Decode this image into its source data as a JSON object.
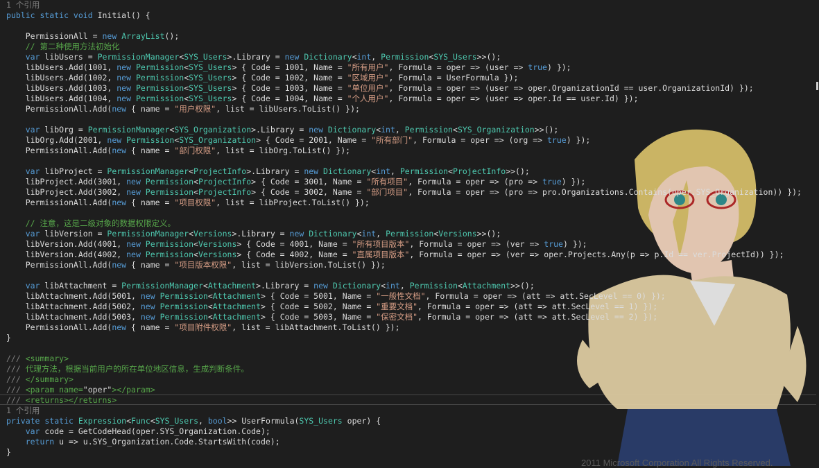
{
  "editor": {
    "lines": [
      {
        "kind": "ref",
        "tokens": [
          [
            "g",
            "1 个引用"
          ]
        ]
      },
      {
        "tokens": [
          [
            "k",
            "public static void "
          ],
          [
            "p",
            "Initial() {"
          ]
        ]
      },
      {
        "tokens": [
          [
            "p",
            ""
          ]
        ]
      },
      {
        "tokens": [
          [
            "p",
            "    PermissionAll = "
          ],
          [
            "k",
            "new "
          ],
          [
            "t",
            "ArrayList"
          ],
          [
            "p",
            "();"
          ]
        ]
      },
      {
        "tokens": [
          [
            "c",
            "    // 第二种使用方法初始化"
          ]
        ]
      },
      {
        "tokens": [
          [
            "k",
            "    var "
          ],
          [
            "p",
            "libUsers = "
          ],
          [
            "t",
            "PermissionManager"
          ],
          [
            "p",
            "<"
          ],
          [
            "t",
            "SYS_Users"
          ],
          [
            "p",
            ">.Library = "
          ],
          [
            "k",
            "new "
          ],
          [
            "t",
            "Dictionary"
          ],
          [
            "p",
            "<"
          ],
          [
            "k",
            "int"
          ],
          [
            "p",
            ", "
          ],
          [
            "t",
            "Permission"
          ],
          [
            "p",
            "<"
          ],
          [
            "t",
            "SYS_Users"
          ],
          [
            "p",
            ">>();"
          ]
        ]
      },
      {
        "tokens": [
          [
            "p",
            "    libUsers.Add(1001, "
          ],
          [
            "k",
            "new "
          ],
          [
            "t",
            "Permission"
          ],
          [
            "p",
            "<"
          ],
          [
            "t",
            "SYS_Users"
          ],
          [
            "p",
            "> { Code = 1001, Name = "
          ],
          [
            "s",
            "\"所有用户\""
          ],
          [
            "p",
            ", Formula = oper => (user => "
          ],
          [
            "k",
            "true"
          ],
          [
            "p",
            ") });"
          ]
        ]
      },
      {
        "tokens": [
          [
            "p",
            "    libUsers.Add(1002, "
          ],
          [
            "k",
            "new "
          ],
          [
            "t",
            "Permission"
          ],
          [
            "p",
            "<"
          ],
          [
            "t",
            "SYS_Users"
          ],
          [
            "p",
            "> { Code = 1002, Name = "
          ],
          [
            "s",
            "\"区域用户\""
          ],
          [
            "p",
            ", Formula = UserFormula });"
          ]
        ]
      },
      {
        "tokens": [
          [
            "p",
            "    libUsers.Add(1003, "
          ],
          [
            "k",
            "new "
          ],
          [
            "t",
            "Permission"
          ],
          [
            "p",
            "<"
          ],
          [
            "t",
            "SYS_Users"
          ],
          [
            "p",
            "> { Code = 1003, Name = "
          ],
          [
            "s",
            "\"单位用户\""
          ],
          [
            "p",
            ", Formula = oper => (user => oper.OrganizationId == user.OrganizationId) });"
          ]
        ]
      },
      {
        "tokens": [
          [
            "p",
            "    libUsers.Add(1004, "
          ],
          [
            "k",
            "new "
          ],
          [
            "t",
            "Permission"
          ],
          [
            "p",
            "<"
          ],
          [
            "t",
            "SYS_Users"
          ],
          [
            "p",
            "> { Code = 1004, Name = "
          ],
          [
            "s",
            "\"个人用户\""
          ],
          [
            "p",
            ", Formula = oper => (user => oper.Id == user.Id) });"
          ]
        ]
      },
      {
        "tokens": [
          [
            "p",
            "    PermissionAll.Add("
          ],
          [
            "k",
            "new "
          ],
          [
            "p",
            "{ name = "
          ],
          [
            "s",
            "\"用户权限\""
          ],
          [
            "p",
            ", list = libUsers.ToList() });"
          ]
        ]
      },
      {
        "tokens": [
          [
            "p",
            ""
          ]
        ]
      },
      {
        "tokens": [
          [
            "k",
            "    var "
          ],
          [
            "p",
            "libOrg = "
          ],
          [
            "t",
            "PermissionManager"
          ],
          [
            "p",
            "<"
          ],
          [
            "t",
            "SYS_Organization"
          ],
          [
            "p",
            ">.Library = "
          ],
          [
            "k",
            "new "
          ],
          [
            "t",
            "Dictionary"
          ],
          [
            "p",
            "<"
          ],
          [
            "k",
            "int"
          ],
          [
            "p",
            ", "
          ],
          [
            "t",
            "Permission"
          ],
          [
            "p",
            "<"
          ],
          [
            "t",
            "SYS_Organization"
          ],
          [
            "p",
            ">>();"
          ]
        ]
      },
      {
        "tokens": [
          [
            "p",
            "    libOrg.Add(2001, "
          ],
          [
            "k",
            "new "
          ],
          [
            "t",
            "Permission"
          ],
          [
            "p",
            "<"
          ],
          [
            "t",
            "SYS_Organization"
          ],
          [
            "p",
            "> { Code = 2001, Name = "
          ],
          [
            "s",
            "\"所有部门\""
          ],
          [
            "p",
            ", Formula = oper => (org => "
          ],
          [
            "k",
            "true"
          ],
          [
            "p",
            ") });"
          ]
        ]
      },
      {
        "tokens": [
          [
            "p",
            "    PermissionAll.Add("
          ],
          [
            "k",
            "new "
          ],
          [
            "p",
            "{ name = "
          ],
          [
            "s",
            "\"部门权限\""
          ],
          [
            "p",
            ", list = libOrg.ToList() });"
          ]
        ]
      },
      {
        "tokens": [
          [
            "p",
            ""
          ]
        ]
      },
      {
        "tokens": [
          [
            "k",
            "    var "
          ],
          [
            "p",
            "libProject = "
          ],
          [
            "t",
            "PermissionManager"
          ],
          [
            "p",
            "<"
          ],
          [
            "t",
            "ProjectInfo"
          ],
          [
            "p",
            ">.Library = "
          ],
          [
            "k",
            "new "
          ],
          [
            "t",
            "Dictionary"
          ],
          [
            "p",
            "<"
          ],
          [
            "k",
            "int"
          ],
          [
            "p",
            ", "
          ],
          [
            "t",
            "Permission"
          ],
          [
            "p",
            "<"
          ],
          [
            "t",
            "ProjectInfo"
          ],
          [
            "p",
            ">>();"
          ]
        ]
      },
      {
        "tokens": [
          [
            "p",
            "    libProject.Add(3001, "
          ],
          [
            "k",
            "new "
          ],
          [
            "t",
            "Permission"
          ],
          [
            "p",
            "<"
          ],
          [
            "t",
            "ProjectInfo"
          ],
          [
            "p",
            "> { Code = 3001, Name = "
          ],
          [
            "s",
            "\"所有项目\""
          ],
          [
            "p",
            ", Formula = oper => (pro => "
          ],
          [
            "k",
            "true"
          ],
          [
            "p",
            ") });"
          ]
        ]
      },
      {
        "tokens": [
          [
            "p",
            "    libProject.Add(3002, "
          ],
          [
            "k",
            "new "
          ],
          [
            "t",
            "Permission"
          ],
          [
            "p",
            "<"
          ],
          [
            "t",
            "ProjectInfo"
          ],
          [
            "p",
            "> { Code = 3002, Name = "
          ],
          [
            "s",
            "\"部门项目\""
          ],
          [
            "p",
            ", Formula = oper => (pro => pro.Organizations.Contains(oper.SYS_Organization)) });"
          ]
        ]
      },
      {
        "tokens": [
          [
            "p",
            "    PermissionAll.Add("
          ],
          [
            "k",
            "new "
          ],
          [
            "p",
            "{ name = "
          ],
          [
            "s",
            "\"项目权限\""
          ],
          [
            "p",
            ", list = libProject.ToList() });"
          ]
        ]
      },
      {
        "tokens": [
          [
            "p",
            ""
          ]
        ]
      },
      {
        "tokens": [
          [
            "c",
            "    // 注意，这是二级对象的数据权限定义。"
          ]
        ]
      },
      {
        "tokens": [
          [
            "k",
            "    var "
          ],
          [
            "p",
            "libVersion = "
          ],
          [
            "t",
            "PermissionManager"
          ],
          [
            "p",
            "<"
          ],
          [
            "t",
            "Versions"
          ],
          [
            "p",
            ">.Library = "
          ],
          [
            "k",
            "new "
          ],
          [
            "t",
            "Dictionary"
          ],
          [
            "p",
            "<"
          ],
          [
            "k",
            "int"
          ],
          [
            "p",
            ", "
          ],
          [
            "t",
            "Permission"
          ],
          [
            "p",
            "<"
          ],
          [
            "t",
            "Versions"
          ],
          [
            "p",
            ">>();"
          ]
        ]
      },
      {
        "tokens": [
          [
            "p",
            "    libVersion.Add(4001, "
          ],
          [
            "k",
            "new "
          ],
          [
            "t",
            "Permission"
          ],
          [
            "p",
            "<"
          ],
          [
            "t",
            "Versions"
          ],
          [
            "p",
            "> { Code = 4001, Name = "
          ],
          [
            "s",
            "\"所有项目版本\""
          ],
          [
            "p",
            ", Formula = oper => (ver => "
          ],
          [
            "k",
            "true"
          ],
          [
            "p",
            ") });"
          ]
        ]
      },
      {
        "tokens": [
          [
            "p",
            "    libVersion.Add(4002, "
          ],
          [
            "k",
            "new "
          ],
          [
            "t",
            "Permission"
          ],
          [
            "p",
            "<"
          ],
          [
            "t",
            "Versions"
          ],
          [
            "p",
            "> { Code = 4002, Name = "
          ],
          [
            "s",
            "\"直属项目版本\""
          ],
          [
            "p",
            ", Formula = oper => (ver => oper.Projects.Any(p => p.Id == ver.ProjectId)) });"
          ]
        ]
      },
      {
        "tokens": [
          [
            "p",
            "    PermissionAll.Add("
          ],
          [
            "k",
            "new "
          ],
          [
            "p",
            "{ name = "
          ],
          [
            "s",
            "\"项目版本权限\""
          ],
          [
            "p",
            ", list = libVersion.ToList() });"
          ]
        ]
      },
      {
        "tokens": [
          [
            "p",
            ""
          ]
        ]
      },
      {
        "tokens": [
          [
            "k",
            "    var "
          ],
          [
            "p",
            "libAttachment = "
          ],
          [
            "t",
            "PermissionManager"
          ],
          [
            "p",
            "<"
          ],
          [
            "t",
            "Attachment"
          ],
          [
            "p",
            ">.Library = "
          ],
          [
            "k",
            "new "
          ],
          [
            "t",
            "Dictionary"
          ],
          [
            "p",
            "<"
          ],
          [
            "k",
            "int"
          ],
          [
            "p",
            ", "
          ],
          [
            "t",
            "Permission"
          ],
          [
            "p",
            "<"
          ],
          [
            "t",
            "Attachment"
          ],
          [
            "p",
            ">>();"
          ]
        ]
      },
      {
        "tokens": [
          [
            "p",
            "    libAttachment.Add(5001, "
          ],
          [
            "k",
            "new "
          ],
          [
            "t",
            "Permission"
          ],
          [
            "p",
            "<"
          ],
          [
            "t",
            "Attachment"
          ],
          [
            "p",
            "> { Code = 5001, Name = "
          ],
          [
            "s",
            "\"一般性文档\""
          ],
          [
            "p",
            ", Formula = oper => (att => att.SecLevel == 0) });"
          ]
        ]
      },
      {
        "tokens": [
          [
            "p",
            "    libAttachment.Add(5002, "
          ],
          [
            "k",
            "new "
          ],
          [
            "t",
            "Permission"
          ],
          [
            "p",
            "<"
          ],
          [
            "t",
            "Attachment"
          ],
          [
            "p",
            "> { Code = 5002, Name = "
          ],
          [
            "s",
            "\"重要文档\""
          ],
          [
            "p",
            ", Formula = oper => (att => att.SecLevel == 1) });"
          ]
        ]
      },
      {
        "tokens": [
          [
            "p",
            "    libAttachment.Add(5003, "
          ],
          [
            "k",
            "new "
          ],
          [
            "t",
            "Permission"
          ],
          [
            "p",
            "<"
          ],
          [
            "t",
            "Attachment"
          ],
          [
            "p",
            "> { Code = 5003, Name = "
          ],
          [
            "s",
            "\"保密文档\""
          ],
          [
            "p",
            ", Formula = oper => (att => att.SecLevel == 2) });"
          ]
        ]
      },
      {
        "tokens": [
          [
            "p",
            "    PermissionAll.Add("
          ],
          [
            "k",
            "new "
          ],
          [
            "p",
            "{ name = "
          ],
          [
            "s",
            "\"项目附件权限\""
          ],
          [
            "p",
            ", list = libAttachment.ToList() });"
          ]
        ]
      },
      {
        "tokens": [
          [
            "p",
            "}"
          ]
        ]
      },
      {
        "tokens": [
          [
            "p",
            ""
          ]
        ]
      },
      {
        "tokens": [
          [
            "g",
            "/// "
          ],
          [
            "c",
            "<summary>"
          ]
        ]
      },
      {
        "tokens": [
          [
            "g",
            "/// "
          ],
          [
            "c",
            "代理方法，根据当前用户的所在单位地区信息，生成判断条件。"
          ]
        ]
      },
      {
        "tokens": [
          [
            "g",
            "/// "
          ],
          [
            "c",
            "</summary>"
          ]
        ]
      },
      {
        "tokens": [
          [
            "g",
            "/// "
          ],
          [
            "c",
            "<param name="
          ],
          [
            "p",
            "\"oper\""
          ],
          [
            "c",
            "></param>"
          ]
        ]
      },
      {
        "tokens": [
          [
            "g",
            "/// "
          ],
          [
            "c",
            "<returns></returns>"
          ]
        ]
      },
      {
        "kind": "ref",
        "tokens": [
          [
            "g",
            "1 个引用"
          ]
        ]
      },
      {
        "tokens": [
          [
            "k",
            "private static "
          ],
          [
            "t",
            "Expression"
          ],
          [
            "p",
            "<"
          ],
          [
            "t",
            "Func"
          ],
          [
            "p",
            "<"
          ],
          [
            "t",
            "SYS_Users"
          ],
          [
            "p",
            ", "
          ],
          [
            "k",
            "bool"
          ],
          [
            "p",
            ">> UserFormula("
          ],
          [
            "t",
            "SYS_Users "
          ],
          [
            "p",
            "oper) {"
          ]
        ]
      },
      {
        "tokens": [
          [
            "k",
            "    var "
          ],
          [
            "p",
            "code = GetCodeHead(oper.SYS_Organization.Code);"
          ]
        ]
      },
      {
        "tokens": [
          [
            "k",
            "    return "
          ],
          [
            "p",
            "u => u.SYS_Organization.Code.StartsWith(code);"
          ]
        ]
      },
      {
        "tokens": [
          [
            "p",
            "}"
          ]
        ]
      }
    ]
  },
  "background": {
    "copyright": "2011 Microsoft Corporation All Rights Reserved."
  },
  "colors": {
    "keyword": "#569cd6",
    "type": "#4ec9b0",
    "string": "#d69d85",
    "comment": "#57a64a",
    "text": "#dcdcdc"
  }
}
